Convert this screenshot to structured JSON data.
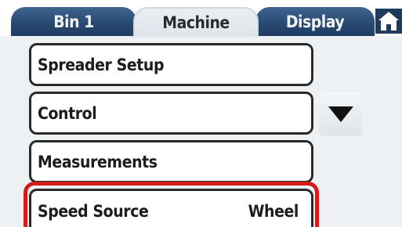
{
  "tabs": [
    {
      "label": "Bin 1",
      "active": false
    },
    {
      "label": "Machine",
      "active": true
    },
    {
      "label": "Display",
      "active": false
    }
  ],
  "home": {
    "icon": "home-icon"
  },
  "menu": {
    "items": [
      {
        "label": "Spreader Setup",
        "value": ""
      },
      {
        "label": "Control",
        "value": ""
      },
      {
        "label": "Measurements",
        "value": ""
      },
      {
        "label": "Speed Source",
        "value": "Wheel"
      }
    ]
  },
  "scroll": {
    "icon": "triangle-down-icon"
  },
  "colors": {
    "tab_inactive": "#26476f",
    "tab_active": "#e3e9ee",
    "highlight": "#d61b1b",
    "border": "#2a2a2a"
  }
}
